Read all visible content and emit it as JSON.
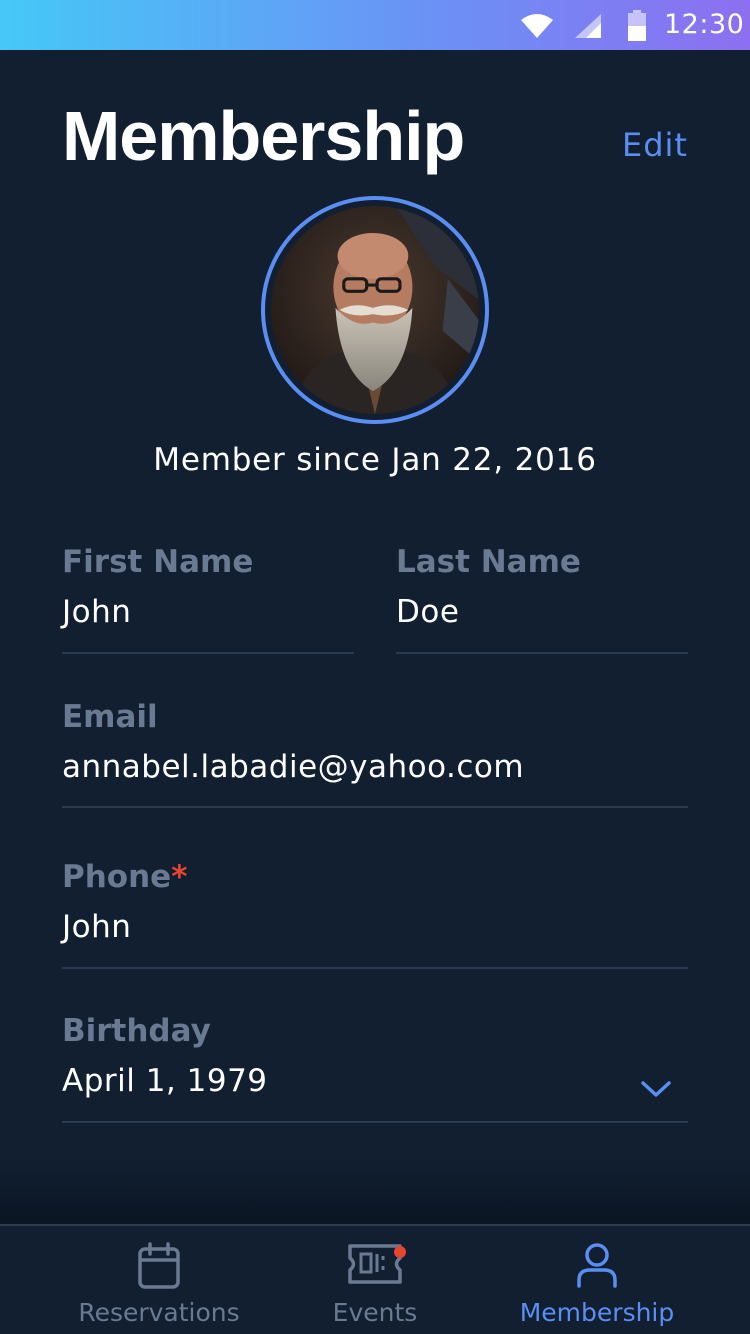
{
  "status_bar": {
    "time": "12:30",
    "icons": [
      "wifi-icon",
      "signal-icon",
      "battery-icon"
    ]
  },
  "header": {
    "title": "Membership",
    "edit_label": "Edit"
  },
  "profile": {
    "member_since": "Member since Jan 22, 2016"
  },
  "form": {
    "first_name": {
      "label": "First Name",
      "value": "John"
    },
    "last_name": {
      "label": "Last Name",
      "value": "Doe"
    },
    "email": {
      "label": "Email",
      "value": "annabel.labadie@yahoo.com"
    },
    "phone": {
      "label": "Phone",
      "required_mark": "*",
      "value": "John"
    },
    "birthday": {
      "label": "Birthday",
      "value": "April 1, 1979"
    }
  },
  "nav": {
    "items": [
      {
        "label": "Reservations",
        "icon": "calendar-icon",
        "active": false
      },
      {
        "label": "Events",
        "icon": "ticket-icon",
        "active": false,
        "notification_dot": true
      },
      {
        "label": "Membership",
        "icon": "user-icon",
        "active": true
      }
    ]
  },
  "colors": {
    "background": "#111f31",
    "accent": "#5b8ef2",
    "label": "#6a7a92",
    "divider": "#2a3a50",
    "required": "#e8442e"
  }
}
